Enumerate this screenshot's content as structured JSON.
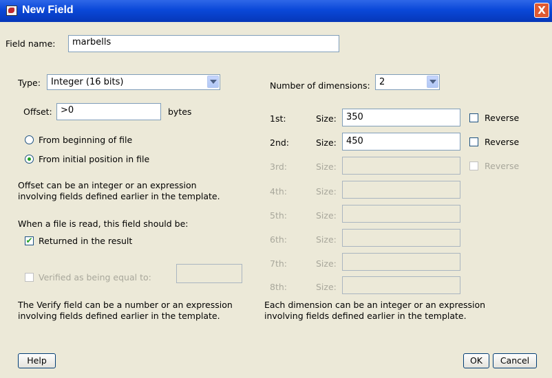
{
  "window": {
    "title": "New Field",
    "close_label": "X"
  },
  "field_name": {
    "label": "Field name:",
    "value": "marbells"
  },
  "type": {
    "label": "Type:",
    "value": "Integer (16 bits)"
  },
  "offset": {
    "label": "Offset:",
    "value": ">0",
    "unit": "bytes"
  },
  "origin": {
    "options": [
      "From beginning of file",
      "From initial position in file"
    ],
    "selected": "From initial position in file"
  },
  "offset_help": [
    "Offset can be an integer or an expression",
    "involving fields defined earlier in the template."
  ],
  "read_label": "When a file is read, this field should be:",
  "returned": {
    "label": "Returned in the result",
    "checked": true
  },
  "verified": {
    "label": "Verified as being equal to:",
    "checked": false,
    "value": ""
  },
  "verify_help": [
    "The Verify field can be a number or an expression",
    "involving fields defined earlier in the template."
  ],
  "dimensions": {
    "label": "Number of dimensions:",
    "value": "2",
    "size_label": "Size:",
    "reverse_label": "Reverse",
    "rows": [
      {
        "label": "1st:",
        "size": "350"
      },
      {
        "label": "2nd:",
        "size": "450"
      },
      {
        "label": "3rd:",
        "size": ""
      },
      {
        "label": "4th:",
        "size": ""
      },
      {
        "label": "5th:",
        "size": ""
      },
      {
        "label": "6th:",
        "size": ""
      },
      {
        "label": "7th:",
        "size": ""
      },
      {
        "label": "8th:",
        "size": ""
      }
    ],
    "help": [
      "Each dimension can be an integer or an expression",
      "involving fields defined earlier in the template."
    ]
  },
  "buttons": {
    "help": "Help",
    "ok": "OK",
    "cancel": "Cancel"
  }
}
